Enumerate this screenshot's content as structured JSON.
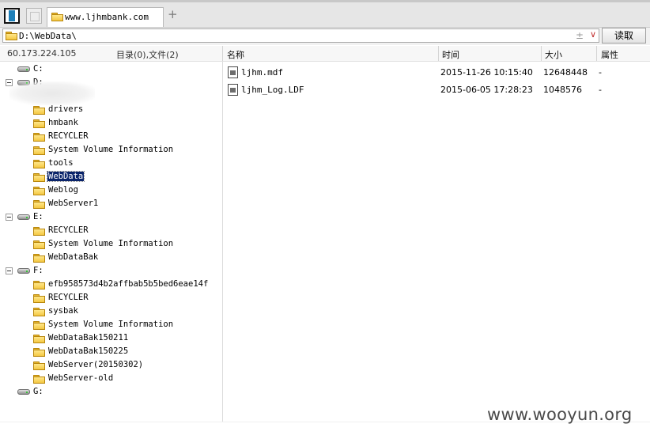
{
  "toolbar": {
    "tab_title": "www.ljhmbank.com",
    "add_tab": "+"
  },
  "address": {
    "path": "D:\\WebData\\",
    "plusminus": "±",
    "dropdown": "∨",
    "read_button": "读取"
  },
  "header": {
    "ip": "60.173.224.105",
    "counts": "目录(0),文件(2)",
    "col_name": "名称",
    "col_time": "时间",
    "col_size": "大小",
    "col_attr": "属性"
  },
  "tree": {
    "drive_c": "C:",
    "drive_d": "D:",
    "d_children": [
      "drivers",
      "hmbank",
      "RECYCLER",
      "System Volume Information",
      "tools",
      "WebData",
      "Weblog",
      "WebServer1"
    ],
    "drive_e": "E:",
    "e_children": [
      "RECYCLER",
      "System Volume Information",
      "WebDataBak"
    ],
    "drive_f": "F:",
    "f_children": [
      "efb958573d4b2affbab5b5bed6eae14f",
      "RECYCLER",
      "sysbak",
      "System Volume Information",
      "WebDataBak150211",
      "WebDataBak150225",
      "WebServer(20150302)",
      "WebServer-old"
    ],
    "drive_g": "G:",
    "selected": "WebData"
  },
  "files": [
    {
      "name": "ljhm.mdf",
      "time": "2015-11-26 10:15:40",
      "size": "12648448",
      "attr": "-"
    },
    {
      "name": "ljhm_Log.LDF",
      "time": "2015-06-05 17:28:23",
      "size": "1048576",
      "attr": "-"
    }
  ],
  "watermark": "www.wooyun.org"
}
